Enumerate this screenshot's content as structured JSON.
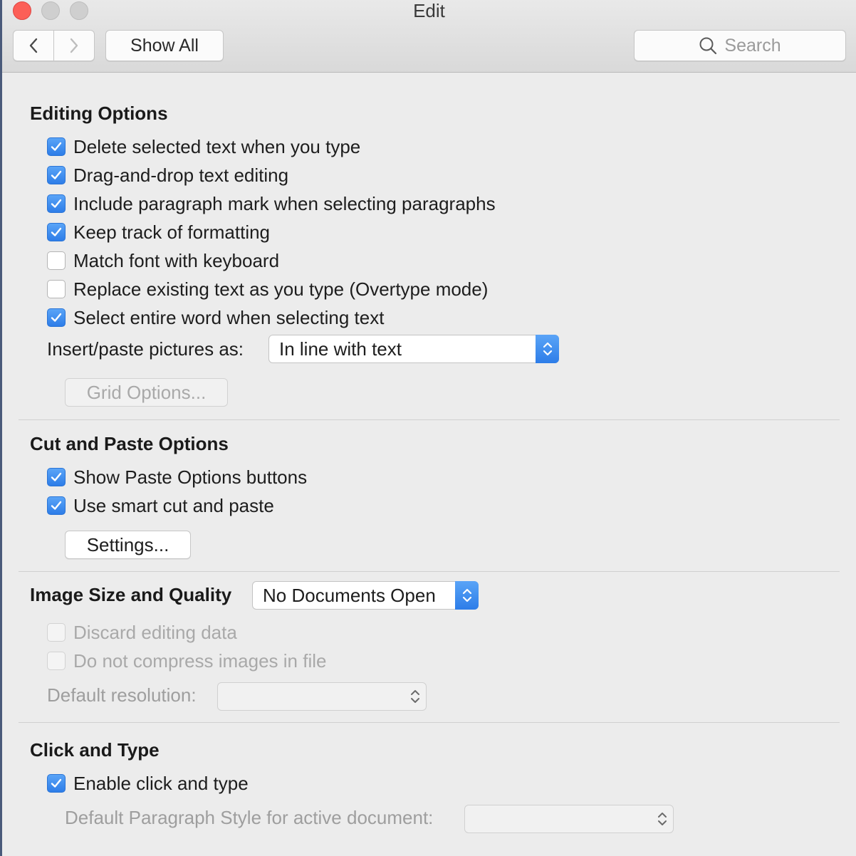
{
  "window": {
    "title": "Edit"
  },
  "toolbar": {
    "show_all_label": "Show All",
    "search_placeholder": "Search"
  },
  "editing": {
    "title": "Editing Options",
    "options": [
      {
        "label": "Delete selected text when you type",
        "checked": true
      },
      {
        "label": "Drag-and-drop text editing",
        "checked": true
      },
      {
        "label": "Include paragraph mark when selecting paragraphs",
        "checked": true
      },
      {
        "label": "Keep track of formatting",
        "checked": true
      },
      {
        "label": "Match font with keyboard",
        "checked": false
      },
      {
        "label": "Replace existing text as you type (Overtype mode)",
        "checked": false
      },
      {
        "label": "Select entire word when selecting text",
        "checked": true
      }
    ],
    "insert_paste_label": "Insert/paste pictures as:",
    "insert_paste_value": "In line with text",
    "grid_options_label": "Grid Options..."
  },
  "cut_paste": {
    "title": "Cut and Paste Options",
    "options": [
      {
        "label": "Show Paste Options buttons",
        "checked": true
      },
      {
        "label": "Use smart cut and paste",
        "checked": true
      }
    ],
    "settings_label": "Settings..."
  },
  "image_quality": {
    "title": "Image Size and Quality",
    "document_value": "No Documents Open",
    "options": [
      {
        "label": "Discard editing data",
        "checked": false,
        "disabled": true
      },
      {
        "label": "Do not compress images in file",
        "checked": false,
        "disabled": true
      }
    ],
    "default_resolution_label": "Default resolution:",
    "default_resolution_value": ""
  },
  "click_type": {
    "title": "Click and Type",
    "options": [
      {
        "label": "Enable click and type",
        "checked": true
      }
    ],
    "paragraph_style_label": "Default Paragraph Style for active document:",
    "paragraph_style_value": ""
  },
  "colors": {
    "accent": "#2d7de8",
    "close_button": "#fc5f57"
  }
}
